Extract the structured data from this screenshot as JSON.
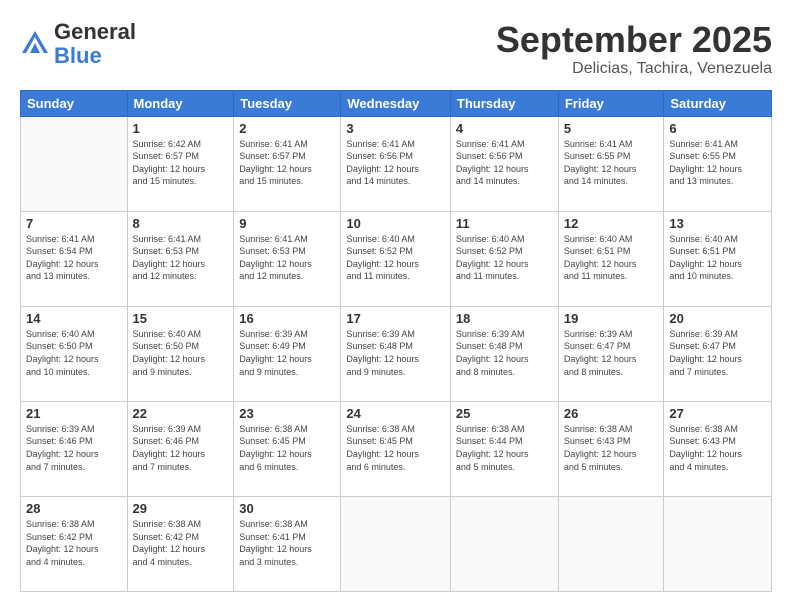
{
  "logo": {
    "general": "General",
    "blue": "Blue"
  },
  "header": {
    "month": "September 2025",
    "location": "Delicias, Tachira, Venezuela"
  },
  "days_of_week": [
    "Sunday",
    "Monday",
    "Tuesday",
    "Wednesday",
    "Thursday",
    "Friday",
    "Saturday"
  ],
  "weeks": [
    [
      {
        "num": "",
        "info": ""
      },
      {
        "num": "1",
        "info": "Sunrise: 6:42 AM\nSunset: 6:57 PM\nDaylight: 12 hours\nand 15 minutes."
      },
      {
        "num": "2",
        "info": "Sunrise: 6:41 AM\nSunset: 6:57 PM\nDaylight: 12 hours\nand 15 minutes."
      },
      {
        "num": "3",
        "info": "Sunrise: 6:41 AM\nSunset: 6:56 PM\nDaylight: 12 hours\nand 14 minutes."
      },
      {
        "num": "4",
        "info": "Sunrise: 6:41 AM\nSunset: 6:56 PM\nDaylight: 12 hours\nand 14 minutes."
      },
      {
        "num": "5",
        "info": "Sunrise: 6:41 AM\nSunset: 6:55 PM\nDaylight: 12 hours\nand 14 minutes."
      },
      {
        "num": "6",
        "info": "Sunrise: 6:41 AM\nSunset: 6:55 PM\nDaylight: 12 hours\nand 13 minutes."
      }
    ],
    [
      {
        "num": "7",
        "info": "Sunrise: 6:41 AM\nSunset: 6:54 PM\nDaylight: 12 hours\nand 13 minutes."
      },
      {
        "num": "8",
        "info": "Sunrise: 6:41 AM\nSunset: 6:53 PM\nDaylight: 12 hours\nand 12 minutes."
      },
      {
        "num": "9",
        "info": "Sunrise: 6:41 AM\nSunset: 6:53 PM\nDaylight: 12 hours\nand 12 minutes."
      },
      {
        "num": "10",
        "info": "Sunrise: 6:40 AM\nSunset: 6:52 PM\nDaylight: 12 hours\nand 11 minutes."
      },
      {
        "num": "11",
        "info": "Sunrise: 6:40 AM\nSunset: 6:52 PM\nDaylight: 12 hours\nand 11 minutes."
      },
      {
        "num": "12",
        "info": "Sunrise: 6:40 AM\nSunset: 6:51 PM\nDaylight: 12 hours\nand 11 minutes."
      },
      {
        "num": "13",
        "info": "Sunrise: 6:40 AM\nSunset: 6:51 PM\nDaylight: 12 hours\nand 10 minutes."
      }
    ],
    [
      {
        "num": "14",
        "info": "Sunrise: 6:40 AM\nSunset: 6:50 PM\nDaylight: 12 hours\nand 10 minutes."
      },
      {
        "num": "15",
        "info": "Sunrise: 6:40 AM\nSunset: 6:50 PM\nDaylight: 12 hours\nand 9 minutes."
      },
      {
        "num": "16",
        "info": "Sunrise: 6:39 AM\nSunset: 6:49 PM\nDaylight: 12 hours\nand 9 minutes."
      },
      {
        "num": "17",
        "info": "Sunrise: 6:39 AM\nSunset: 6:48 PM\nDaylight: 12 hours\nand 9 minutes."
      },
      {
        "num": "18",
        "info": "Sunrise: 6:39 AM\nSunset: 6:48 PM\nDaylight: 12 hours\nand 8 minutes."
      },
      {
        "num": "19",
        "info": "Sunrise: 6:39 AM\nSunset: 6:47 PM\nDaylight: 12 hours\nand 8 minutes."
      },
      {
        "num": "20",
        "info": "Sunrise: 6:39 AM\nSunset: 6:47 PM\nDaylight: 12 hours\nand 7 minutes."
      }
    ],
    [
      {
        "num": "21",
        "info": "Sunrise: 6:39 AM\nSunset: 6:46 PM\nDaylight: 12 hours\nand 7 minutes."
      },
      {
        "num": "22",
        "info": "Sunrise: 6:39 AM\nSunset: 6:46 PM\nDaylight: 12 hours\nand 7 minutes."
      },
      {
        "num": "23",
        "info": "Sunrise: 6:38 AM\nSunset: 6:45 PM\nDaylight: 12 hours\nand 6 minutes."
      },
      {
        "num": "24",
        "info": "Sunrise: 6:38 AM\nSunset: 6:45 PM\nDaylight: 12 hours\nand 6 minutes."
      },
      {
        "num": "25",
        "info": "Sunrise: 6:38 AM\nSunset: 6:44 PM\nDaylight: 12 hours\nand 5 minutes."
      },
      {
        "num": "26",
        "info": "Sunrise: 6:38 AM\nSunset: 6:43 PM\nDaylight: 12 hours\nand 5 minutes."
      },
      {
        "num": "27",
        "info": "Sunrise: 6:38 AM\nSunset: 6:43 PM\nDaylight: 12 hours\nand 4 minutes."
      }
    ],
    [
      {
        "num": "28",
        "info": "Sunrise: 6:38 AM\nSunset: 6:42 PM\nDaylight: 12 hours\nand 4 minutes."
      },
      {
        "num": "29",
        "info": "Sunrise: 6:38 AM\nSunset: 6:42 PM\nDaylight: 12 hours\nand 4 minutes."
      },
      {
        "num": "30",
        "info": "Sunrise: 6:38 AM\nSunset: 6:41 PM\nDaylight: 12 hours\nand 3 minutes."
      },
      {
        "num": "",
        "info": ""
      },
      {
        "num": "",
        "info": ""
      },
      {
        "num": "",
        "info": ""
      },
      {
        "num": "",
        "info": ""
      }
    ]
  ]
}
